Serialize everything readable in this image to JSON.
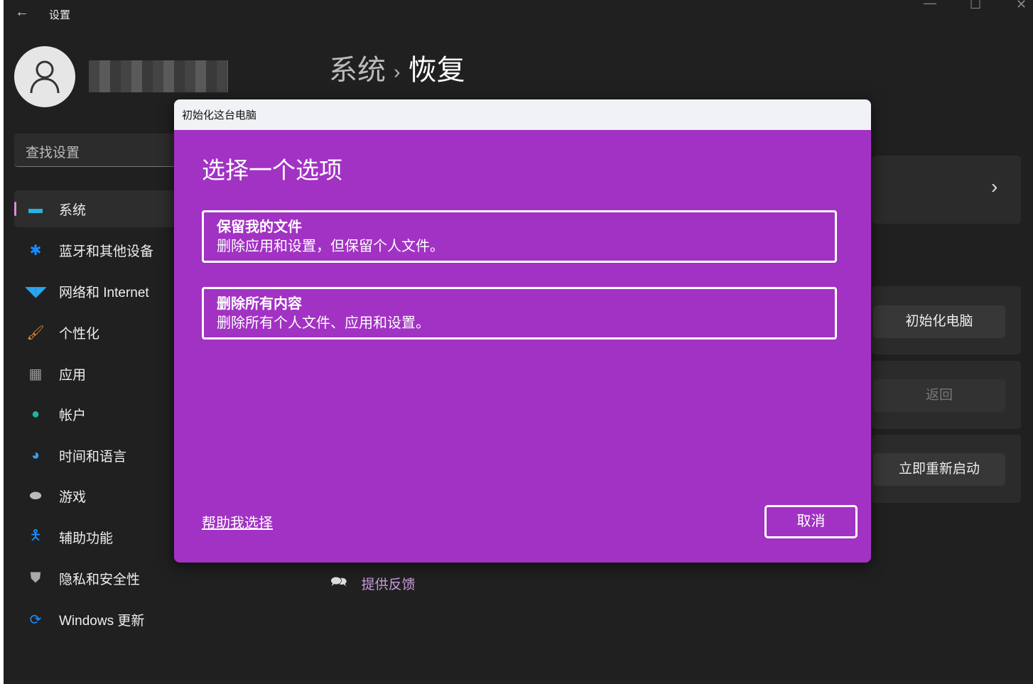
{
  "window": {
    "title": "设置",
    "controls": {
      "minimize": "—",
      "maximize": "☐",
      "close": "✕"
    }
  },
  "search": {
    "placeholder": "查找设置"
  },
  "nav": [
    {
      "label": "系统",
      "icon": "monitor-icon"
    },
    {
      "label": "蓝牙和其他设备",
      "icon": "bluetooth-icon"
    },
    {
      "label": "网络和 Internet",
      "icon": "wifi-icon"
    },
    {
      "label": "个性化",
      "icon": "brush-icon"
    },
    {
      "label": "应用",
      "icon": "apps-icon"
    },
    {
      "label": "帐户",
      "icon": "account-icon"
    },
    {
      "label": "时间和语言",
      "icon": "globe-clock-icon"
    },
    {
      "label": "游戏",
      "icon": "gamepad-icon"
    },
    {
      "label": "辅助功能",
      "icon": "accessibility-icon"
    },
    {
      "label": "隐私和安全性",
      "icon": "shield-icon"
    },
    {
      "label": "Windows 更新",
      "icon": "update-icon"
    }
  ],
  "breadcrumb": {
    "parent": "系统",
    "sep": "›",
    "current": "恢复"
  },
  "right": {
    "reset_button": "初始化电脑",
    "goback_button": "返回",
    "restart_button": "立即重新启动",
    "chevron": "›"
  },
  "feedback": "提供反馈",
  "dialog": {
    "title": "初始化这台电脑",
    "heading": "选择一个选项",
    "options": [
      {
        "title": "保留我的文件",
        "desc": "删除应用和设置，但保留个人文件。"
      },
      {
        "title": "删除所有内容",
        "desc": "删除所有个人文件、应用和设置。"
      }
    ],
    "help_link": "帮助我选择",
    "cancel": "取消"
  }
}
